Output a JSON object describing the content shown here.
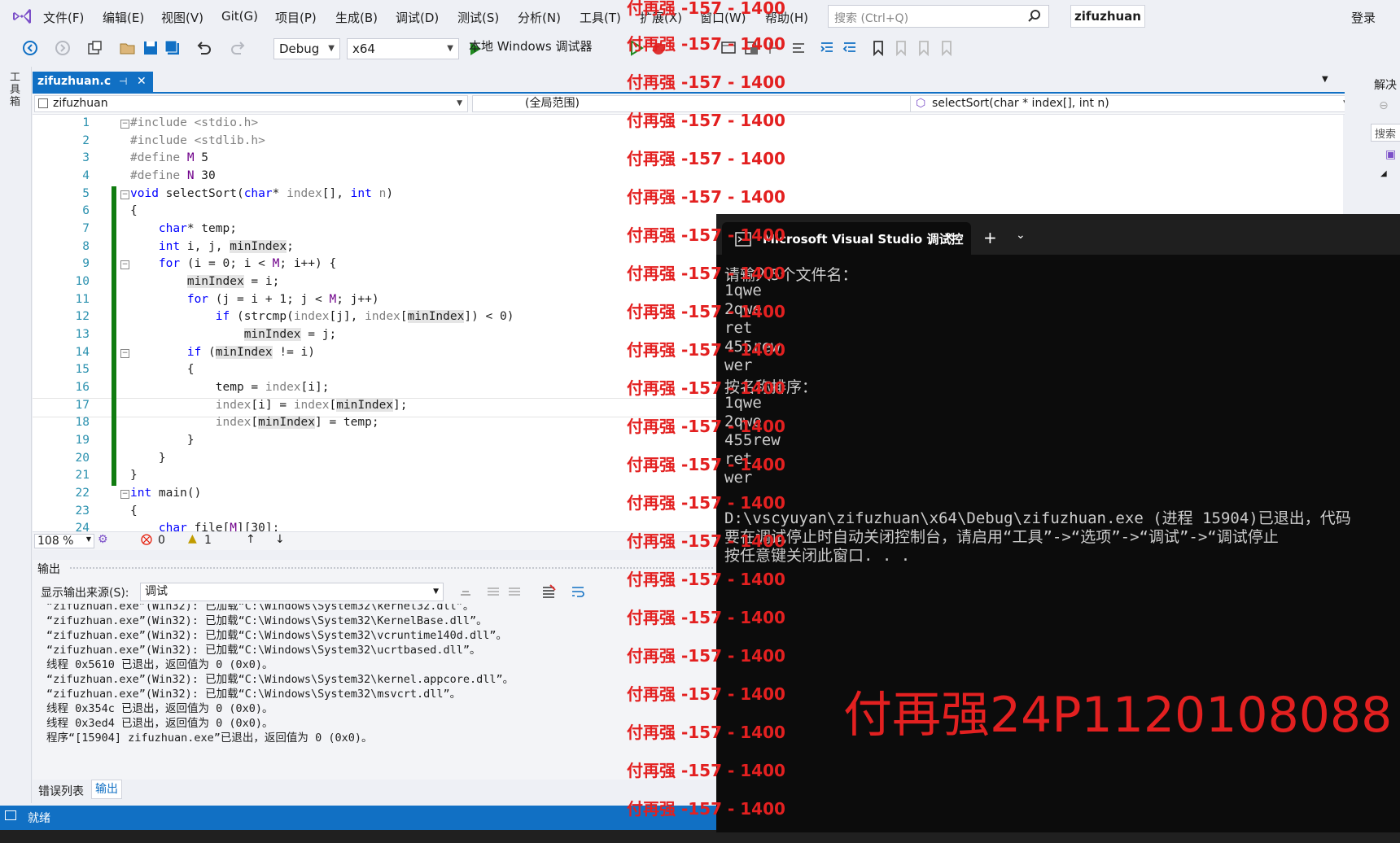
{
  "menu": {
    "items": [
      "文件(F)",
      "编辑(E)",
      "视图(V)",
      "Git(G)",
      "项目(P)",
      "生成(B)",
      "调试(D)",
      "测试(S)",
      "分析(N)",
      "工具(T)",
      "扩展(X)",
      "窗口(W)",
      "帮助(H)"
    ],
    "search_placeholder": "搜索 (Ctrl+Q)",
    "solution": "zifuzhuan",
    "login": "登录"
  },
  "toolbar": {
    "config": "Debug",
    "platform": "x64",
    "debugger": "本地 Windows 调试器"
  },
  "toolstrip": {
    "label": "工具箱"
  },
  "editor": {
    "tab": "zifuzhuan.c",
    "nav_project": "zifuzhuan",
    "nav_scope": "(全局范围)",
    "nav_function": "selectSort(char * index[], int n)",
    "line_numbers": [
      "1",
      "2",
      "3",
      "4",
      "5",
      "6",
      "7",
      "8",
      "9",
      "10",
      "11",
      "12",
      "13",
      "14",
      "15",
      "16",
      "17",
      "18",
      "19",
      "20",
      "21",
      "22",
      "23",
      "24"
    ],
    "zoom": "108 %",
    "errors": "0",
    "warnings": "1"
  },
  "output": {
    "title": "输出",
    "source_label": "显示输出来源(S):",
    "source_value": "调试",
    "lines": [
      "“zifuzhuan.exe”(Win32): 已加载“C:\\Windows\\System32\\KernelBase.dll”。",
      "“zifuzhuan.exe”(Win32): 已加载“C:\\Windows\\System32\\vcruntime140d.dll”。",
      "“zifuzhuan.exe”(Win32): 已加载“C:\\Windows\\System32\\ucrtbased.dll”。",
      "线程 0x5610 已退出，返回值为 0 (0x0)。",
      "“zifuzhuan.exe”(Win32): 已加载“C:\\Windows\\System32\\kernel.appcore.dll”。",
      "“zifuzhuan.exe”(Win32): 已加载“C:\\Windows\\System32\\msvcrt.dll”。",
      "线程 0x354c 已退出，返回值为 0 (0x0)。",
      "线程 0x3ed4 已退出，返回值为 0 (0x0)。",
      "程序“[15904] zifuzhuan.exe”已退出，返回值为 0 (0x0)。"
    ],
    "tab_errors": "错误列表",
    "tab_output": "输出"
  },
  "status": {
    "text": "就绪"
  },
  "right_panel": {
    "label1": "解决",
    "label2": "搜索"
  },
  "console": {
    "title": "Microsoft Visual Studio 调试控",
    "lines": [
      "请输入5个文件名：",
      "1qwe",
      "2qwe",
      "ret",
      "455rew",
      "wer",
      "按名称排序：",
      "1qwe",
      "2qwe",
      "455rew",
      "ret",
      "wer",
      "",
      "D:\\vscyuyan\\zifuzhuan\\x64\\Debug\\zifuzhuan.exe (进程 15904)已退出，代码",
      "要在调试停止时自动关闭控制台，请启用“工具”->“选项”->“调试”->“调试停止",
      "按任意键关闭此窗口. . ."
    ]
  },
  "watermark": {
    "repeat": "付再强 -157 - 1400",
    "big": "付再强24P1120108088"
  },
  "colors": {
    "accent": "#1170c4",
    "watermark": "#e32020",
    "green_bar": "#107c10"
  }
}
